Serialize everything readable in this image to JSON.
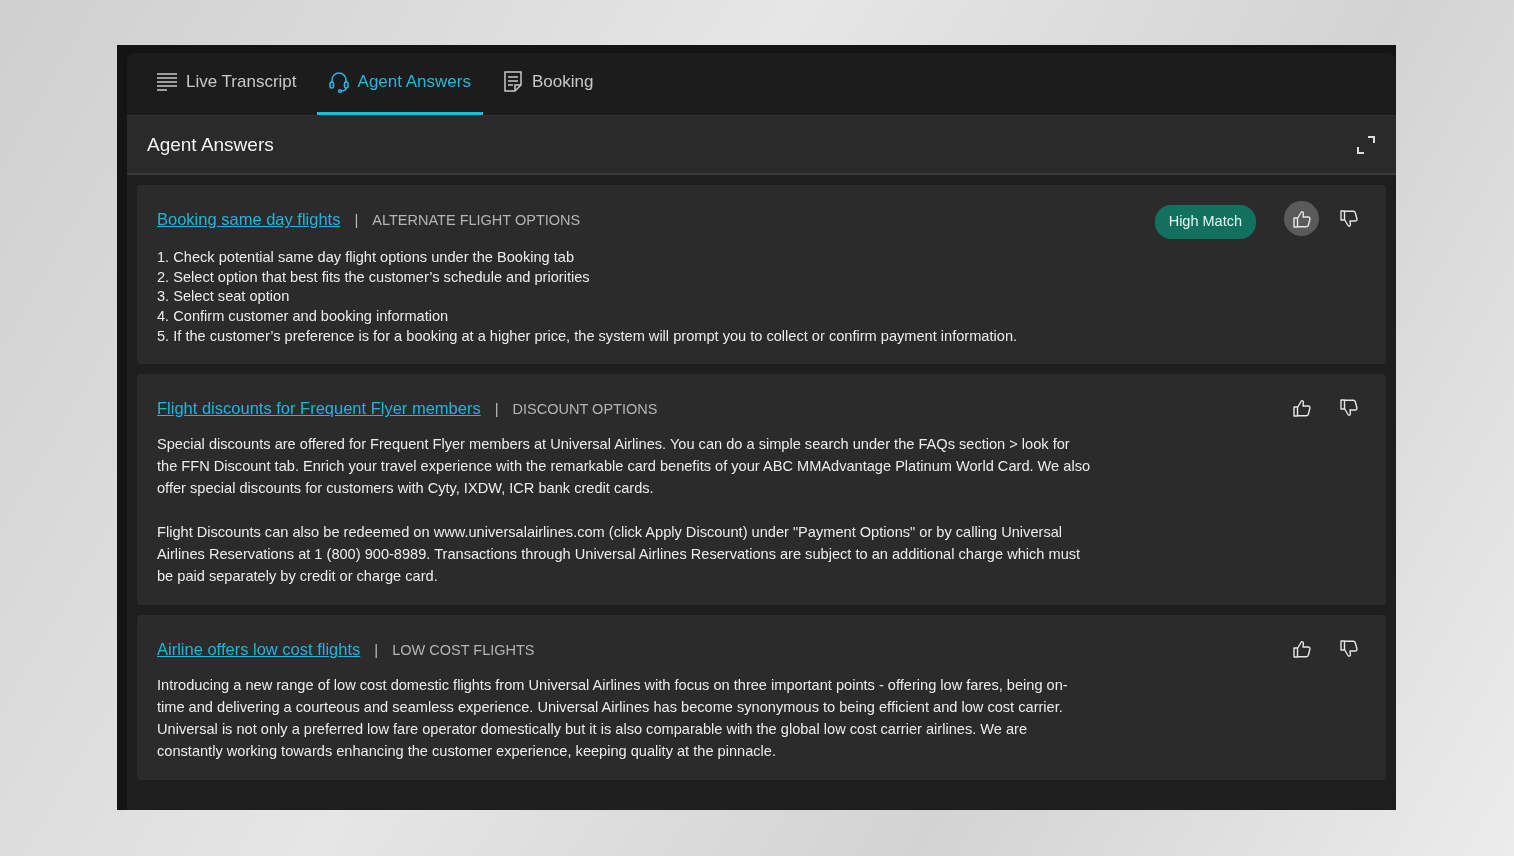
{
  "tabs": [
    {
      "label": "Live Transcript",
      "kind": "lines",
      "selected": false
    },
    {
      "label": "Agent Answers",
      "kind": "headset",
      "selected": true
    },
    {
      "label": "Booking",
      "kind": "document",
      "selected": false
    }
  ],
  "panel": {
    "title": "Agent Answers"
  },
  "answers": [
    {
      "title": "Booking same day flights",
      "separator": "|",
      "category": "ALTERNATE FLIGHT OPTIONS",
      "badge": "High Match",
      "liked": true,
      "disliked": false,
      "kind": "steps",
      "body": [
        "1. Check potential same day flight options under the Booking tab",
        "2. Select option that best fits the customer’s schedule and priorities",
        "3. Select seat option",
        "4. Confirm customer and booking information",
        "5. If the customer’s preference is for a booking at a higher price, the system will prompt you to collect or confirm payment information."
      ]
    },
    {
      "title": "Flight discounts for Frequent Flyer members",
      "separator": "|",
      "category": "DISCOUNT OPTIONS",
      "liked": false,
      "disliked": false,
      "kind": "paragraphs",
      "body": [
        "Special discounts are offered for Frequent Flyer members at Universal Airlines. You can do a simple search under the FAQs section > look for the FFN Discount tab. Enrich your travel experience with the remarkable card benefits of your ABC MMAdvantage Platinum World Card. We also offer special discounts for customers with Cyty, IXDW, ICR bank credit cards.",
        "Flight Discounts can also be redeemed on www.universalairlines.com (click Apply Discount) under \"Payment Options\" or by calling Universal Airlines Reservations at 1 (800) 900-8989. Transactions through Universal Airlines Reservations are subject to an additional charge which must be paid separately by credit or charge card."
      ]
    },
    {
      "title": "Airline offers low cost flights",
      "separator": "|",
      "category": "LOW COST FLIGHTS",
      "liked": false,
      "disliked": false,
      "kind": "paragraphs",
      "body": [
        "Introducing a new range of low cost domestic flights from Universal Airlines with focus on three important points - offering low fares, being on-time and delivering a courteous and seamless experience. Universal Airlines has become synonymous to being efficient and low cost carrier. Universal is not only a preferred low fare operator domestically but it is also comparable with the global low cost carrier airlines. We are constantly working towards enhancing the customer experience, keeping quality at the pinnacle."
      ]
    }
  ]
}
